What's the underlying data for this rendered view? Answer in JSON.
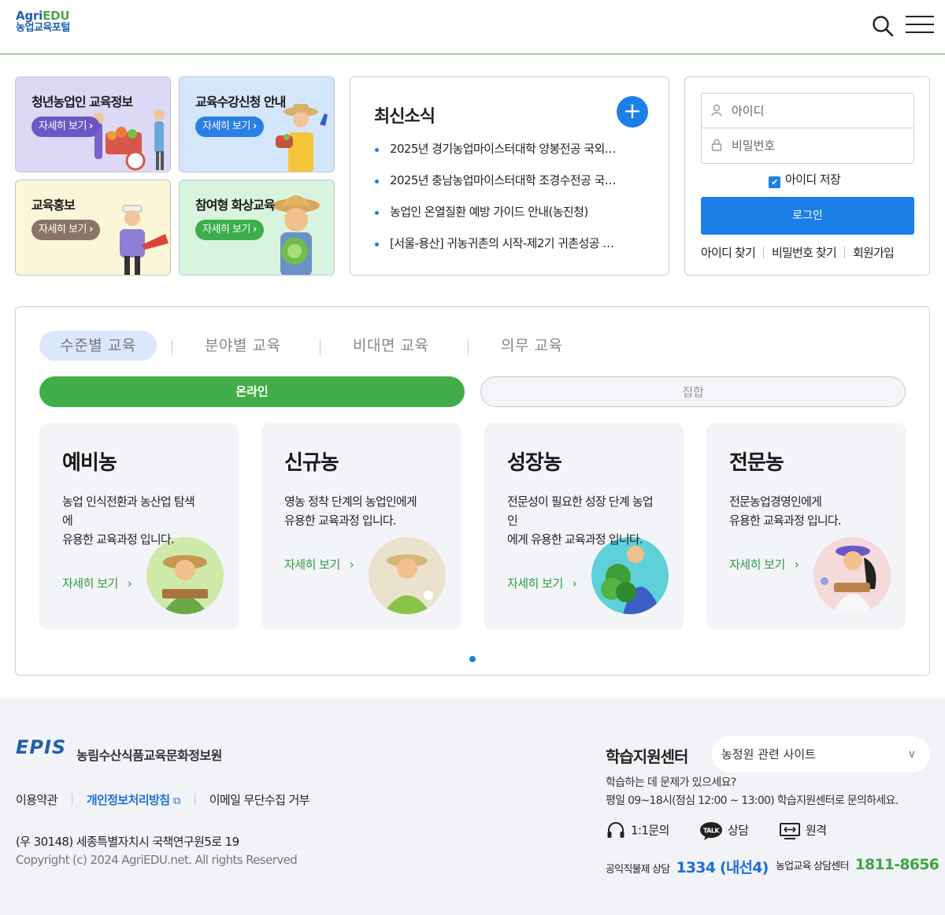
{
  "header": {
    "logo_line1_a": "Agri",
    "logo_line1_b": "EDU",
    "logo_line2": "농업교육포털"
  },
  "quick_tiles": [
    {
      "title": "청년농업인 교육정보",
      "button": "자세히 보기",
      "color": "#dcd9f6",
      "button_color": "#6c58c4"
    },
    {
      "title": "교육수강신청 안내",
      "button": "자세히 보기",
      "color": "#d4e6fb",
      "button_color": "#2a7fe4"
    },
    {
      "title": "교육홍보",
      "button": "자세히 보기",
      "color": "#fbf6d8",
      "button_color": "#8a7468"
    },
    {
      "title": "참여형 화상교육",
      "button": "자세히 보기",
      "color": "#d9f4de",
      "button_color": "#3cae4c"
    }
  ],
  "news": {
    "title": "최신소식",
    "more": "+",
    "items": [
      "2025년 경기농업마이스터대학 양봉전공 국외…",
      "2025년 충남농업마이스터대학 조경수전공 국…",
      "농업인 온열질환 예방 가이드 안내(농진청)",
      "[서울-용산] 귀농귀촌의 시작-제2기 귀촌성공 …"
    ]
  },
  "login": {
    "id_placeholder": "아이디",
    "pw_placeholder": "비밀번호",
    "save_id": "아이디 저장",
    "save_checked": true,
    "button": "로그인",
    "find_id": "아이디 찾기",
    "find_pw": "비밀번호 찾기",
    "signup": "회원가입"
  },
  "education": {
    "tabs": [
      "수준별 교육",
      "분야별 교육",
      "비대면 교육",
      "의무 교육"
    ],
    "active_tab": 0,
    "modes": [
      "온라인",
      "집합"
    ],
    "active_mode": 0,
    "cards": [
      {
        "title": "예비농",
        "desc": [
          "농업 인식전환과 농산업 탐색",
          "에",
          "유용한 교육과정 입니다."
        ],
        "more": "자세히 보기"
      },
      {
        "title": "신규농",
        "desc": [
          "영농 정착 단계의 농업인에게",
          "유용한 교육과정 입니다."
        ],
        "more": "자세히 보기"
      },
      {
        "title": "성장농",
        "desc": [
          "전문성이 필요한 성장 단계 농업",
          "인",
          "에게 유용한 교육과정 입니다."
        ],
        "more": "자세히 보기"
      },
      {
        "title": "전문농",
        "desc": [
          "전문농업경영인에게",
          "유용한 교육과정 입니다."
        ],
        "more": "자세히 보기"
      }
    ],
    "pagination_pages": 1,
    "pagination_current": 1
  },
  "footer": {
    "logo_mark": "EPIS",
    "org_name": "농림수산식품교육문화정보원",
    "links": [
      "이용약관",
      "개인정보처리방침",
      "이메일 무단수집 거부"
    ],
    "address": "(우 30148) 세종특별자치시 국책연구원5로 19",
    "copyright": "Copyright (c) 2024 AgriEDU.net. All rights Reserved",
    "support_title": "학습지원센터",
    "related_select": "농정원 관련 사이트",
    "help_line1": "학습하는 데 문제가 있으세요?",
    "help_line2": "평일 09~18시(점심 12:00 ~ 13:00) 학습지원센터로 문의하세요.",
    "contacts": [
      {
        "label": "1:1문의",
        "icon": "headset-icon"
      },
      {
        "label": "상담",
        "icon": "talk-bubble-icon"
      },
      {
        "label": "원격",
        "icon": "remote-monitor-icon"
      }
    ],
    "phones": [
      {
        "label": "공익직불제 상담",
        "number": "1334 (내선4)",
        "color": "#1c6fd8"
      },
      {
        "label": "농업교육 상담센터",
        "number": "1811-8656",
        "color": "#3ea745"
      }
    ]
  }
}
